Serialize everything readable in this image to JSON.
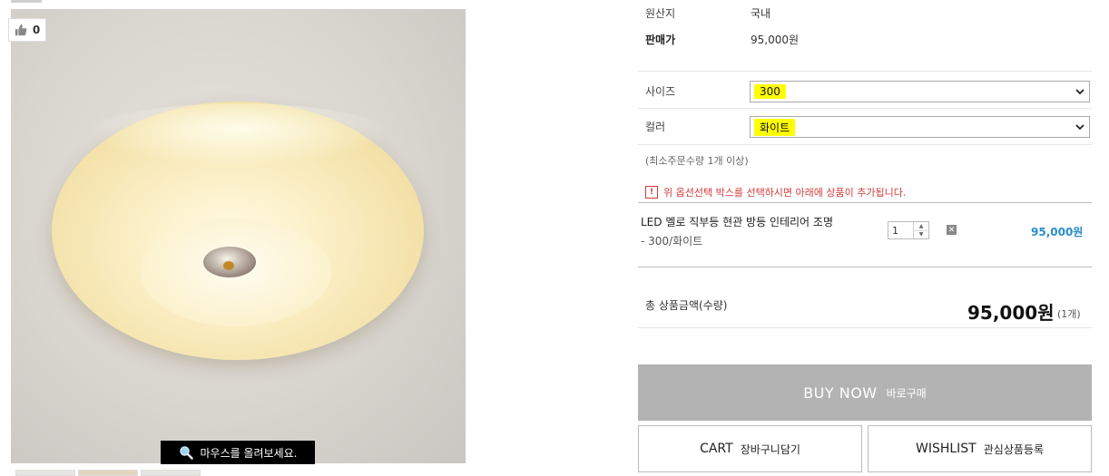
{
  "image": {
    "like_count": "0",
    "zoom_hint": "마우스를 올려보세요."
  },
  "info": {
    "origin_label": "원산지",
    "origin_value": "국내",
    "price_label": "판매가",
    "price_value": "95,000원"
  },
  "options": {
    "size_label": "사이즈",
    "size_value": "300",
    "color_label": "컬러",
    "color_value": "화이트",
    "min_qty": "(최소주문수량 1개 이상)",
    "notice": "위 옵션선택 박스를 선택하시면 아래에 상품이 추가됩니다."
  },
  "selected_item": {
    "name": "LED 멜로 직부등 현관 방등 인테리어 조명",
    "option": "- 300/화이트",
    "quantity": "1",
    "price": "95,000원"
  },
  "total": {
    "label": "총 상품금액(수량)",
    "price": "95,000원",
    "count": "(1개)"
  },
  "buttons": {
    "buy_en": "BUY NOW",
    "buy_ko": "바로구매",
    "cart_en": "CART",
    "cart_ko": "장바구니담기",
    "wishlist_en": "WISHLIST",
    "wishlist_ko": "관심상품등록"
  },
  "colors": {
    "highlight": "#ffff00",
    "price_blue": "#2a8cc7",
    "notice_red": "#d23a3a",
    "buy_bg": "#b3b3b3"
  }
}
